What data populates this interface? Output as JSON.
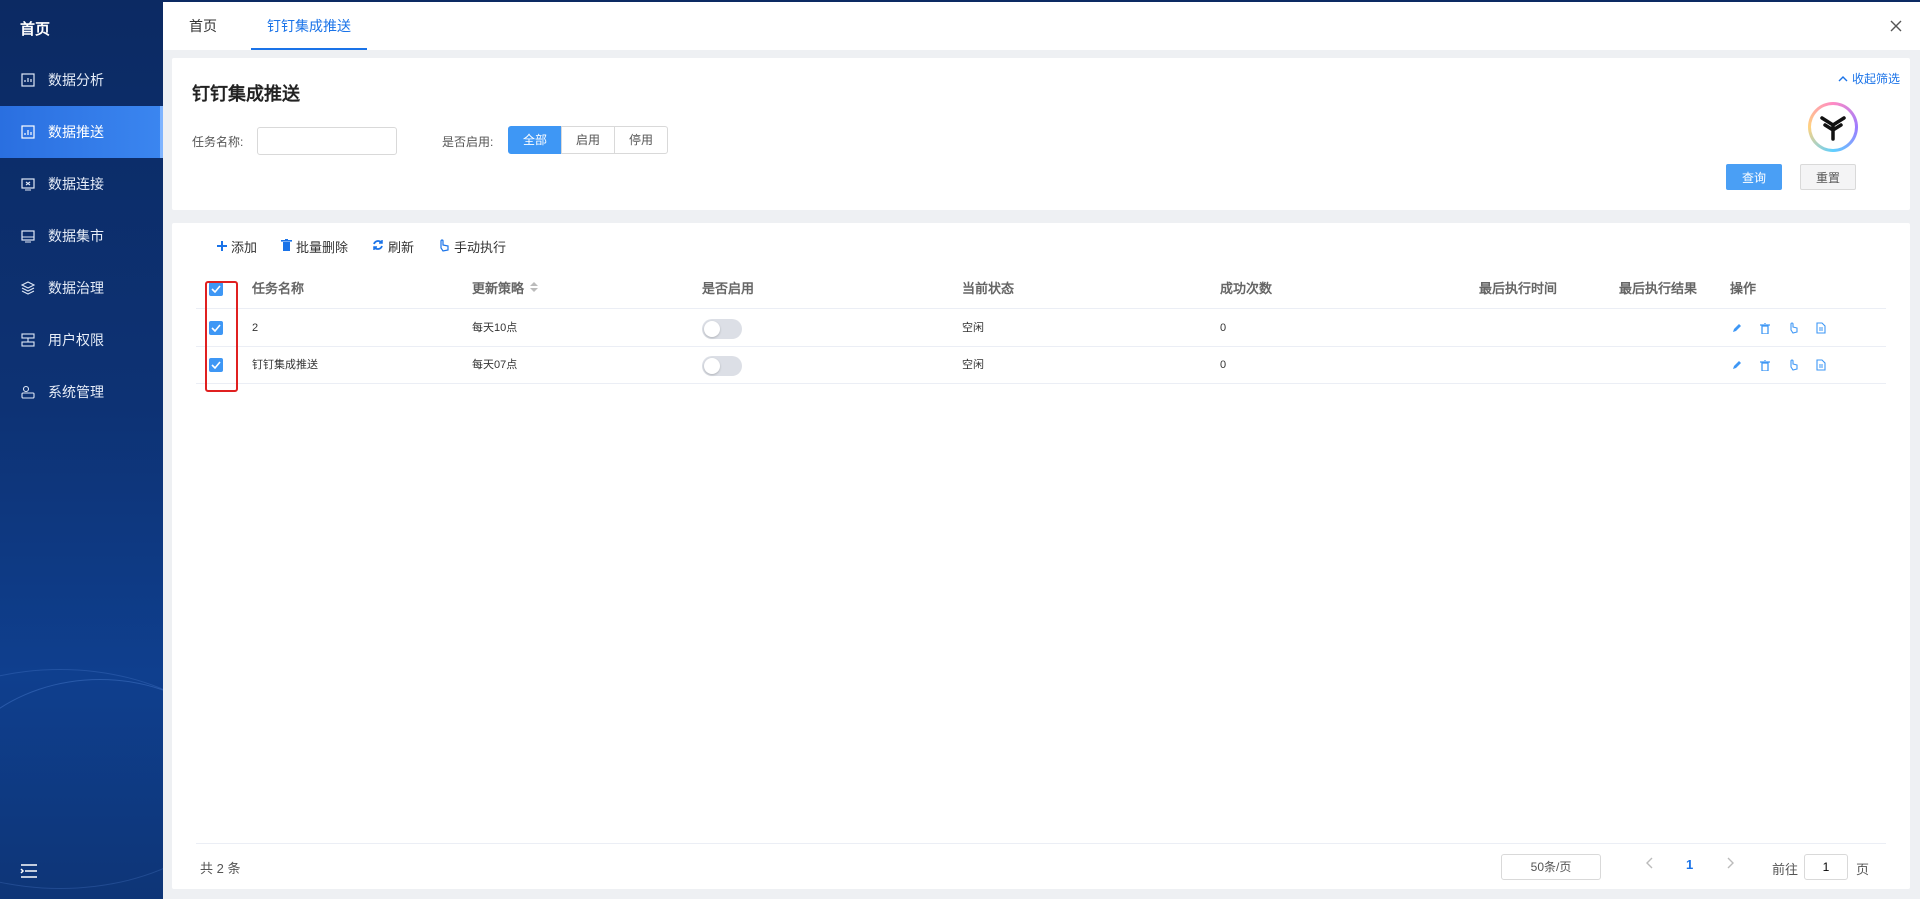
{
  "sidebar": {
    "home": "首页",
    "items": [
      {
        "label": "数据分析",
        "icon": "analysis-icon"
      },
      {
        "label": "数据推送",
        "icon": "push-icon",
        "active": true
      },
      {
        "label": "数据连接",
        "icon": "connection-icon"
      },
      {
        "label": "数据集市",
        "icon": "market-icon"
      },
      {
        "label": "数据治理",
        "icon": "governance-icon"
      },
      {
        "label": "用户权限",
        "icon": "permission-icon"
      },
      {
        "label": "系统管理",
        "icon": "system-icon"
      }
    ]
  },
  "tabs": [
    {
      "label": "首页"
    },
    {
      "label": "钉钉集成推送",
      "active": true
    }
  ],
  "filter": {
    "title": "钉钉集成推送",
    "task_name_label": "任务名称:",
    "task_name_value": "",
    "enabled_label": "是否启用:",
    "enabled_options": [
      "全部",
      "启用",
      "停用"
    ],
    "enabled_selected": "全部",
    "collapse_label": "收起筛选",
    "query_label": "查询",
    "reset_label": "重置"
  },
  "toolbar": {
    "add": "添加",
    "batch_delete": "批量删除",
    "refresh": "刷新",
    "manual_run": "手动执行"
  },
  "table": {
    "headers": [
      "任务名称",
      "更新策略",
      "是否启用",
      "当前状态",
      "成功次数",
      "最后执行时间",
      "最后执行结果",
      "操作"
    ],
    "rows": [
      {
        "name": "2",
        "strategy": "每天10点",
        "enabled": false,
        "status": "空闲",
        "success": "0",
        "last_time": "",
        "last_result": ""
      },
      {
        "name": "钉钉集成推送",
        "strategy": "每天07点",
        "enabled": false,
        "status": "空闲",
        "success": "0",
        "last_time": "",
        "last_result": ""
      }
    ]
  },
  "pagination": {
    "total": "共 2 条",
    "page_size": "50条/页",
    "current_page": "1",
    "goto_prefix": "前往",
    "goto_value": "1",
    "goto_suffix": "页"
  },
  "colors": {
    "accent": "#1a73e8",
    "sidebar_bg": "#0d3274",
    "highlight": "#e02020"
  }
}
